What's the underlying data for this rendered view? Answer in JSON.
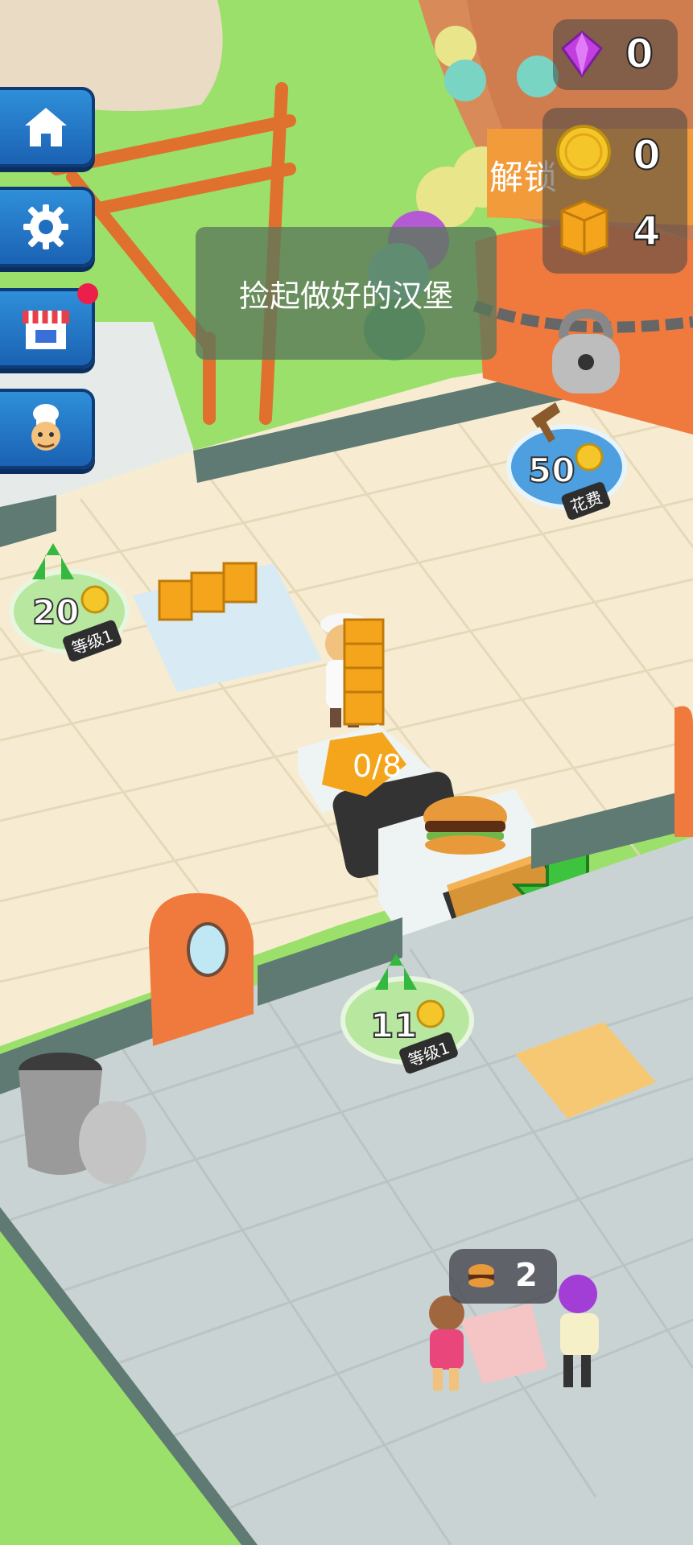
{
  "resources": {
    "gems": "0",
    "coins": "0",
    "boxes": "4"
  },
  "hint": {
    "text": "捡起做好的汉堡"
  },
  "unlock_sign": {
    "text": "解锁"
  },
  "spend_zone": {
    "price": "50",
    "label": "花费"
  },
  "left_upgrade": {
    "price": "20",
    "label": "等级1"
  },
  "grill_upgrade": {
    "price": "11",
    "label": "等级1"
  },
  "conveyor_counter": {
    "text": "0/8"
  },
  "order": {
    "count": "2"
  },
  "side_menu": [
    "home",
    "settings",
    "shop",
    "chef"
  ],
  "colors": {
    "grass": "#9be06a",
    "floor_tile": "#f7ecd2",
    "kitchen_tile": "#c9d3d3",
    "wall": "#5f7a72",
    "accent_orange": "#f07a3e",
    "button_blue": "#1f6fc1"
  }
}
